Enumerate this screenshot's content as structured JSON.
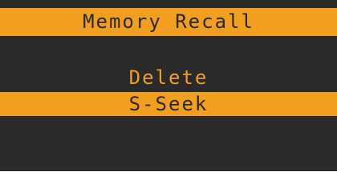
{
  "header": {
    "title": "Memory Recall"
  },
  "menu": {
    "items": [
      {
        "label": "Delete",
        "selected": false
      },
      {
        "label": "S-Seek",
        "selected": true
      }
    ]
  },
  "colors": {
    "accent": "#f29f1f",
    "background": "#2a2a2a"
  }
}
